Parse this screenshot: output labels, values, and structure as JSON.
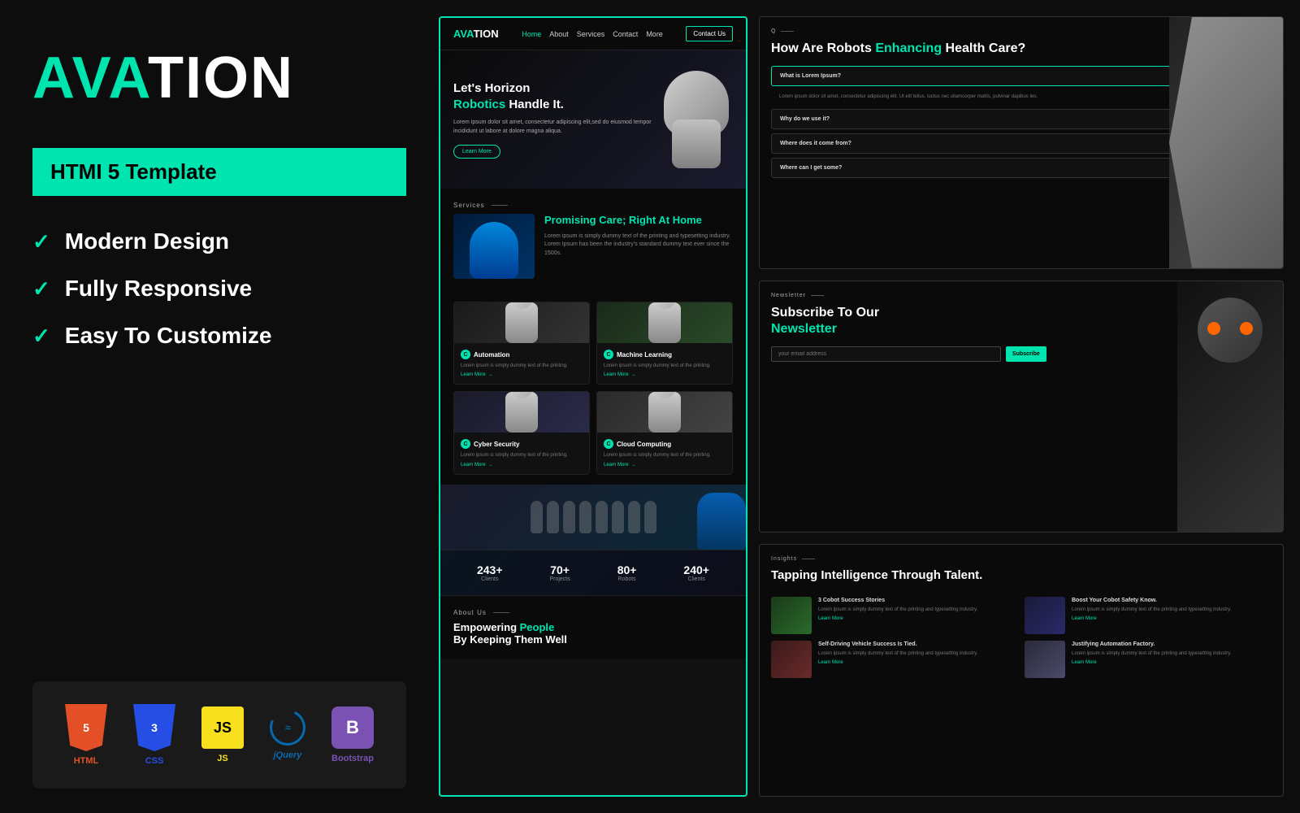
{
  "brand": {
    "name_green": "AVA",
    "name_white": "TION",
    "badge": "HTMI 5 Template"
  },
  "features": [
    {
      "id": "modern-design",
      "label": "Modern Design"
    },
    {
      "id": "fully-responsive",
      "label": "Fully Responsive"
    },
    {
      "id": "easy-customize",
      "label": "Easy To Customize"
    }
  ],
  "tech_stack": [
    {
      "id": "html5",
      "label": "HTML",
      "version": "5"
    },
    {
      "id": "css3",
      "label": "CSS",
      "version": "3"
    },
    {
      "id": "js",
      "label": "JS"
    },
    {
      "id": "jquery",
      "label": "jQuery"
    },
    {
      "id": "bootstrap",
      "label": "B"
    }
  ],
  "nav": {
    "logo_green": "AVA",
    "logo_white": "TION",
    "links": [
      "Home",
      "About",
      "Services",
      "Contact",
      "More"
    ],
    "cta": "Contact Us"
  },
  "hero": {
    "title_white": "Let's Horizon",
    "title_green": "Robotics",
    "title_end": "Handle It.",
    "description": "Lorem ipsum dolor sit amet, consectetur adipiscing elit,sed do eiusmod tempor incididunt ut labore at dolore magna aliqua.",
    "cta": "Learn More"
  },
  "services_section": {
    "label": "Services",
    "title": "Promising Care; Right At Home",
    "description": "Lorem ipsum is simply dummy text of the printing and typesetting industry. Lorem Ipsum has been the industry's standard dummy text ever since the 1500s."
  },
  "service_cards": [
    {
      "id": "automation",
      "title": "Automation",
      "desc": "Lorem ipsum is simply dummy text of the printing.",
      "link": "Learn More"
    },
    {
      "id": "machine-learning",
      "title": "Machine Learning",
      "desc": "Lorem ipsum is simply dummy text of the printing.",
      "link": "Learn More"
    },
    {
      "id": "cyber-security",
      "title": "Cyber Security",
      "desc": "Lorem ipsum is simply dummy text of the printing.",
      "link": "Learn More"
    },
    {
      "id": "cloud-computing",
      "title": "Cloud Computing",
      "desc": "Lorem ipsum is simply dummy text of the printing.",
      "link": "Learn More"
    }
  ],
  "stats": [
    {
      "id": "clients",
      "number": "243+",
      "label": "Clients"
    },
    {
      "id": "projects",
      "number": "70+",
      "label": "Projects"
    },
    {
      "id": "robots",
      "number": "80+",
      "label": "Robots"
    },
    {
      "id": "clients2",
      "number": "240+",
      "label": "Clients"
    }
  ],
  "about": {
    "label": "About Us",
    "title_white": "Empowering",
    "title_green": "People",
    "title_end": "By Keeping Them Well"
  },
  "right_card_1": {
    "section_label": "Q",
    "title_white": "How Are Robots",
    "title_green": "Enhancing",
    "title_end": "Health Care?",
    "faq_items": [
      {
        "id": "faq1",
        "question": "What is Lorem Ipsum?",
        "open": true,
        "answer": "Lorem ipsum dolor sit amet, consectetur adipiscing elit. Ut elit tellus, luctus nec ullamcorper mattis, pulvinar dapibus leo."
      },
      {
        "id": "faq2",
        "question": "Why do we use it?",
        "open": false,
        "answer": ""
      },
      {
        "id": "faq3",
        "question": "Where does it come from?",
        "open": false,
        "answer": ""
      },
      {
        "id": "faq4",
        "question": "Where can I get some?",
        "open": false,
        "answer": ""
      }
    ]
  },
  "right_card_2": {
    "section_label": "Newsletter",
    "title_white": "Subscribe To Our",
    "title_green": "Newsletter",
    "email_placeholder": "your email address",
    "subscribe_btn": "Subscribe"
  },
  "right_card_3": {
    "section_label": "Insights",
    "title_white": "Tapping",
    "title_green": "Intelligence",
    "title_end": "Through Talent.",
    "insights": [
      {
        "id": "insight1",
        "title": "3 Cobot Success Stories",
        "desc": "Lorem ipsum is simply dummy text of the printing and typesetting industry.",
        "link": "Learn More"
      },
      {
        "id": "insight2",
        "title": "Boost Your Cobot Safety Know.",
        "desc": "Lorem ipsum is simply dummy text of the printing and typesetting industry.",
        "link": "Learn More"
      },
      {
        "id": "insight3",
        "title": "Self-Driving Vehicle Success Is Tied.",
        "desc": "Lorem ipsum is simply dummy text of the printing and typesetting industry.",
        "link": "Learn More"
      },
      {
        "id": "insight4",
        "title": "Justifying Automation Factory.",
        "desc": "Lorem ipsum is simply dummy text of the printing and typesetting industry.",
        "link": "Learn More"
      }
    ]
  }
}
